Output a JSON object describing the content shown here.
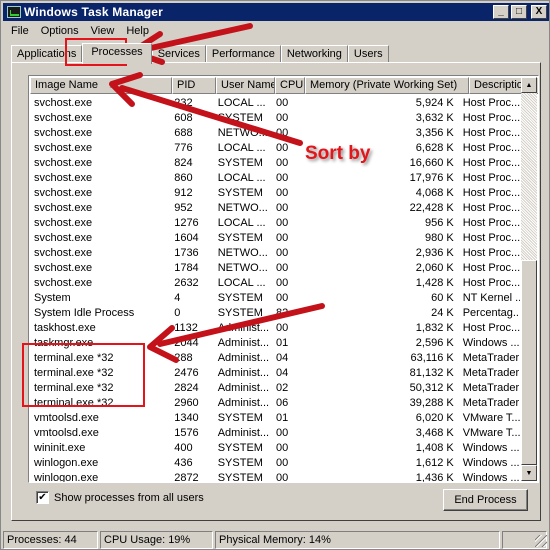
{
  "window": {
    "title": "Windows Task Manager",
    "controls": {
      "minimize": "_",
      "maximize": "□",
      "close": "X"
    }
  },
  "menu": [
    "File",
    "Options",
    "View",
    "Help"
  ],
  "tabs": [
    {
      "label": "Applications",
      "active": false
    },
    {
      "label": "Processes",
      "active": true
    },
    {
      "label": "Services",
      "active": false
    },
    {
      "label": "Performance",
      "active": false
    },
    {
      "label": "Networking",
      "active": false
    },
    {
      "label": "Users",
      "active": false
    }
  ],
  "table": {
    "columns": [
      "Image Name",
      "PID",
      "User Name",
      "CPU",
      "Memory (Private Working Set)",
      "Description"
    ],
    "sort_column": "Image Name",
    "sort_direction": "ascending",
    "rows": [
      [
        "svchost.exe",
        "232",
        "LOCAL ...",
        "00",
        "5,924 K",
        "Host Proc..."
      ],
      [
        "svchost.exe",
        "608",
        "SYSTEM",
        "00",
        "3,632 K",
        "Host Proc..."
      ],
      [
        "svchost.exe",
        "688",
        "NETWO...",
        "00",
        "3,356 K",
        "Host Proc..."
      ],
      [
        "svchost.exe",
        "776",
        "LOCAL ...",
        "00",
        "6,628 K",
        "Host Proc..."
      ],
      [
        "svchost.exe",
        "824",
        "SYSTEM",
        "00",
        "16,660 K",
        "Host Proc..."
      ],
      [
        "svchost.exe",
        "860",
        "LOCAL ...",
        "00",
        "17,976 K",
        "Host Proc..."
      ],
      [
        "svchost.exe",
        "912",
        "SYSTEM",
        "00",
        "4,068 K",
        "Host Proc..."
      ],
      [
        "svchost.exe",
        "952",
        "NETWO...",
        "00",
        "22,428 K",
        "Host Proc..."
      ],
      [
        "svchost.exe",
        "1276",
        "LOCAL ...",
        "00",
        "956 K",
        "Host Proc..."
      ],
      [
        "svchost.exe",
        "1604",
        "SYSTEM",
        "00",
        "980 K",
        "Host Proc..."
      ],
      [
        "svchost.exe",
        "1736",
        "NETWO...",
        "00",
        "2,936 K",
        "Host Proc..."
      ],
      [
        "svchost.exe",
        "1784",
        "NETWO...",
        "00",
        "2,060 K",
        "Host Proc..."
      ],
      [
        "svchost.exe",
        "2632",
        "LOCAL ...",
        "00",
        "1,428 K",
        "Host Proc..."
      ],
      [
        "System",
        "4",
        "SYSTEM",
        "00",
        "60 K",
        "NT Kernel ..."
      ],
      [
        "System Idle Process",
        "0",
        "SYSTEM",
        "82",
        "24 K",
        "Percentag..."
      ],
      [
        "taskhost.exe",
        "1132",
        "Administ...",
        "00",
        "1,832 K",
        "Host Proc..."
      ],
      [
        "taskmgr.exe",
        "2044",
        "Administ...",
        "01",
        "2,596 K",
        "Windows ..."
      ],
      [
        "terminal.exe *32",
        "288",
        "Administ...",
        "04",
        "63,116 K",
        "MetaTrader"
      ],
      [
        "terminal.exe *32",
        "2476",
        "Administ...",
        "04",
        "81,132 K",
        "MetaTrader"
      ],
      [
        "terminal.exe *32",
        "2824",
        "Administ...",
        "02",
        "50,312 K",
        "MetaTrader"
      ],
      [
        "terminal.exe *32",
        "2960",
        "Administ...",
        "06",
        "39,288 K",
        "MetaTrader"
      ],
      [
        "vmtoolsd.exe",
        "1340",
        "SYSTEM",
        "01",
        "6,020 K",
        "VMware T..."
      ],
      [
        "vmtoolsd.exe",
        "1576",
        "Administ...",
        "00",
        "3,468 K",
        "VMware T..."
      ],
      [
        "wininit.exe",
        "400",
        "SYSTEM",
        "00",
        "1,408 K",
        "Windows ..."
      ],
      [
        "winlogon.exe",
        "436",
        "SYSTEM",
        "00",
        "1,612 K",
        "Windows ..."
      ],
      [
        "winlogon.exe",
        "2872",
        "SYSTEM",
        "00",
        "1,436 K",
        "Windows ..."
      ]
    ],
    "scroll": {
      "position_fraction": 1.0,
      "visible_fraction": 0.55
    }
  },
  "show_all_users": {
    "label": "Show processes from all users",
    "checked": true,
    "mark": "✔"
  },
  "end_process_label": "End Process",
  "status": {
    "processes": "Processes: 44",
    "cpu": "CPU Usage: 19%",
    "memory": "Physical Memory: 14%"
  },
  "annotations": {
    "sort_label": "Sort by",
    "color": "#e3141a"
  },
  "icons": {
    "sort_ascending": "▲",
    "scroll_up": "▲",
    "scroll_down": "▼"
  }
}
